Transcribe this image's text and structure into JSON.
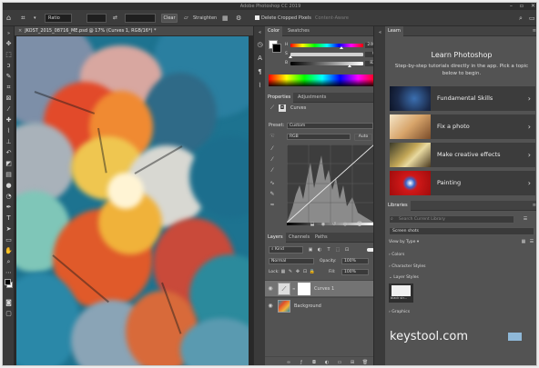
{
  "app": {
    "title": "Adobe Photoshop CC 2019"
  },
  "options": {
    "ratio_label": "Ratio",
    "clear_label": "Clear",
    "straighten_label": "Straighten",
    "delete_cropped_label": "Delete Cropped Pixels",
    "content_aware_label": "Content-Aware"
  },
  "document": {
    "tab_title": "JKOST_2015_08716_ME.psd @ 17% (Curves 1, RGB/16*) *"
  },
  "color_panel": {
    "tabs": [
      "Color",
      "Swatches"
    ],
    "values": [
      "240",
      "0",
      "82"
    ]
  },
  "properties_panel": {
    "tabs": [
      "Properties",
      "Adjustments"
    ],
    "adjustment_name": "Curves",
    "preset_label": "Preset:",
    "preset_value": "Custom",
    "channel_value": "RGB",
    "auto_label": "Auto"
  },
  "layers_panel": {
    "tabs": [
      "Layers",
      "Channels",
      "Paths"
    ],
    "kind_label": "Kind",
    "blend_mode": "Normal",
    "opacity_label": "Opacity:",
    "opacity_value": "100%",
    "lock_label": "Lock:",
    "fill_label": "Fill:",
    "fill_value": "100%",
    "layers": [
      {
        "name": "Curves 1"
      },
      {
        "name": "Background"
      }
    ]
  },
  "learn_panel": {
    "tab": "Learn",
    "title": "Learn Photoshop",
    "description": "Step-by-step tutorials directly in the app. Pick a topic below to begin.",
    "topics": [
      {
        "label": "Fundamental Skills"
      },
      {
        "label": "Fix a photo"
      },
      {
        "label": "Make creative effects"
      },
      {
        "label": "Painting"
      }
    ]
  },
  "libraries_panel": {
    "tab": "Libraries",
    "search_placeholder": "Search Current Library",
    "library_name": "Screen shots",
    "view_label": "View by Type",
    "sections": [
      "Colors",
      "Character Styles",
      "Layer Styles",
      "Graphics"
    ],
    "asset_label": "black str..."
  },
  "watermark": "keystool.com"
}
